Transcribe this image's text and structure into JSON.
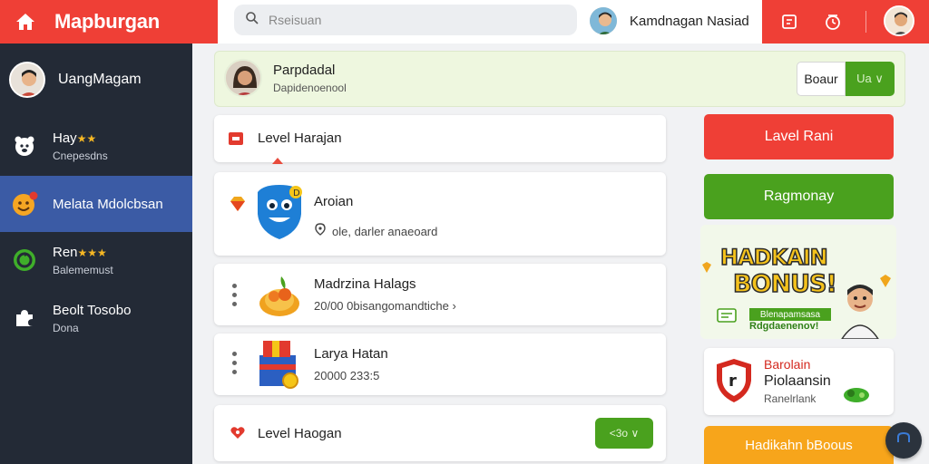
{
  "header": {
    "brand": "Mapburgan",
    "search_placeholder": "Rseisuan",
    "user_name": "Kamdnagan Nasiad"
  },
  "sidebar": {
    "user_name": "UangMagam",
    "items": [
      {
        "label": "Hay",
        "stars": "★★",
        "sub": "Cnepesdns"
      },
      {
        "label": "Melata Mdolcbsan",
        "stars": "",
        "sub": ""
      },
      {
        "label": "Ren",
        "stars": "★★★",
        "sub": "Balememust"
      },
      {
        "label": "Beolt Tosobo",
        "stars": "",
        "sub": "Dona"
      }
    ]
  },
  "notice": {
    "name": "Parpdadal",
    "sub": "Dapidenoenool",
    "btn_white": "Boaur",
    "btn_green": "Ua ∨"
  },
  "cards": [
    {
      "title": "Level Harajan"
    },
    {
      "title": "Aroian",
      "sub": "ole, darler anaeoard"
    },
    {
      "title": "Madrzina Halags",
      "sub": "20/00 0bisangomandtiche ›"
    },
    {
      "title": "Larya Hatan",
      "sub": "20000 233:5"
    },
    {
      "title": "Level Haogan",
      "btn": "<3o ∨"
    }
  ],
  "right": {
    "red_button": "Lavel Rani",
    "green_button": "Ragmonay",
    "bonus_line1": "HADKAIN",
    "bonus_line2": "BONUS!",
    "bonus_tag": "Blenapamsasa",
    "bonus_tag2": "Rdgdaenenov!",
    "promo_a": "Barolain",
    "promo_b": "Piolaansin",
    "promo_c": "Ranelrlank",
    "orange_button": "Hadikahn bBoous"
  },
  "colors": {
    "brand_red": "#ef3f36",
    "sidebar_bg": "#232a36",
    "active_blue": "#3b5ba5",
    "green": "#4aa11e",
    "orange": "#f7a51b"
  }
}
